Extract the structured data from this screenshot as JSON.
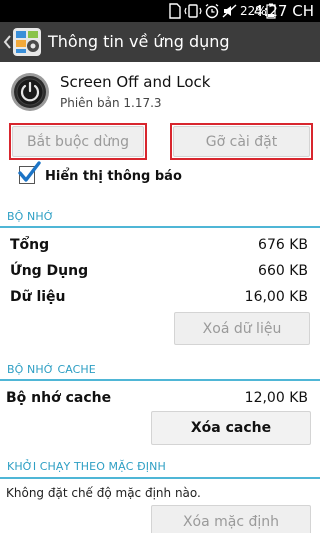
{
  "status_bar": {
    "battery_percent": "22%",
    "time": "4:27 CH",
    "icons": [
      "sim-icon",
      "vibrate-icon",
      "alarm-icon",
      "mute-icon",
      "battery-icon"
    ]
  },
  "action_bar": {
    "title": "Thông tin về ứng dụng",
    "back_icon": "chevron-left-icon",
    "app_icon": "settings-app-icon"
  },
  "app": {
    "name": "Screen Off and Lock",
    "version": "Phiên bản 1.17.3",
    "icon": "power-button-icon"
  },
  "actions": {
    "force_stop_label": "Bắt buộc dừng",
    "uninstall_label": "Gỡ cài đặt",
    "highlight_color": "#d8262e"
  },
  "notifications": {
    "label": "Hiển thị thông báo",
    "checked": true
  },
  "storage": {
    "header": "BỘ NHỚ",
    "rows": [
      {
        "label": "Tổng",
        "value": "676 KB"
      },
      {
        "label": "Ứng Dụng",
        "value": "660 KB"
      },
      {
        "label": "Dữ liệu",
        "value": "16,00 KB"
      }
    ],
    "clear_data_label": "Xoá dữ liệu"
  },
  "cache": {
    "header": "BỘ NHỚ CACHE",
    "label": "Bộ nhớ cache",
    "value": "12,00 KB",
    "clear_cache_label": "Xóa cache"
  },
  "launch_default": {
    "header": "KHỞI CHẠY THEO MẶC ĐỊNH",
    "description": "Không đặt chế độ mặc định nào.",
    "clear_defaults_label": "Xóa mặc định"
  },
  "colors": {
    "accent": "#2e9fc4",
    "action_bar": "#3c3c3c",
    "status_bar": "#000000"
  }
}
